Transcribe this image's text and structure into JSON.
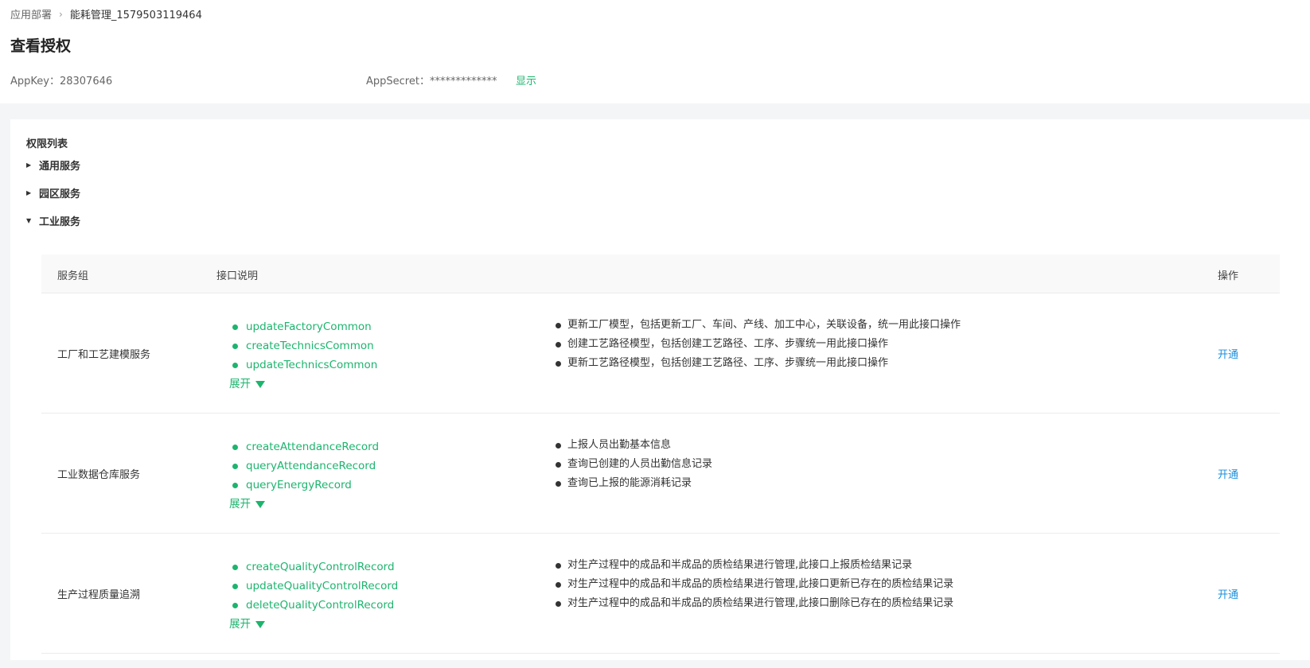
{
  "breadcrumb": {
    "root": "应用部署",
    "current": "能耗管理_1579503119464"
  },
  "page_title": "查看授权",
  "meta": {
    "appkey_label": "AppKey：",
    "appkey_value": "28307646",
    "appsecret_label": "AppSecret：",
    "appsecret_value": "*************",
    "show_label": "显示"
  },
  "permissions": {
    "title": "权限列表",
    "groups": [
      {
        "label": "通用服务",
        "expanded": false
      },
      {
        "label": "园区服务",
        "expanded": false
      },
      {
        "label": "工业服务",
        "expanded": true
      }
    ]
  },
  "table": {
    "headers": {
      "group": "服务组",
      "desc": "接口说明",
      "action": "操作"
    },
    "rows": [
      {
        "group": "工厂和工艺建模服务",
        "apis": [
          "updateFactoryCommon",
          "createTechnicsCommon",
          "updateTechnicsCommon"
        ],
        "descs": [
          "更新工厂模型，包括更新工厂、车间、产线、加工中心，关联设备，统一用此接口操作",
          "创建工艺路径模型，包括创建工艺路径、工序、步骤统一用此接口操作",
          "更新工艺路径模型，包括创建工艺路径、工序、步骤统一用此接口操作"
        ],
        "expand": "展开",
        "action": "开通"
      },
      {
        "group": "工业数据仓库服务",
        "apis": [
          "createAttendanceRecord",
          "queryAttendanceRecord",
          "queryEnergyRecord"
        ],
        "descs": [
          "上报人员出勤基本信息",
          "查询已创建的人员出勤信息记录",
          "查询已上报的能源消耗记录"
        ],
        "expand": "展开",
        "action": "开通"
      },
      {
        "group": "生产过程质量追溯",
        "apis": [
          "createQualityControlRecord",
          "updateQualityControlRecord",
          "deleteQualityControlRecord"
        ],
        "descs": [
          "对生产过程中的成品和半成品的质检结果进行管理,此接口上报质检结果记录",
          "对生产过程中的成品和半成品的质检结果进行管理,此接口更新已存在的质检结果记录",
          "对生产过程中的成品和半成品的质检结果进行管理,此接口删除已存在的质检结果记录"
        ],
        "expand": "展开",
        "action": "开通"
      }
    ]
  },
  "colors": {
    "accent_green": "#1db46e",
    "link_blue": "#1a8fdd"
  },
  "icons": {
    "breadcrumb_sep": "chevron-right-icon",
    "collapsed": "triangle-right-icon",
    "expanded": "triangle-down-icon",
    "expand_caret": "caret-down-icon"
  }
}
